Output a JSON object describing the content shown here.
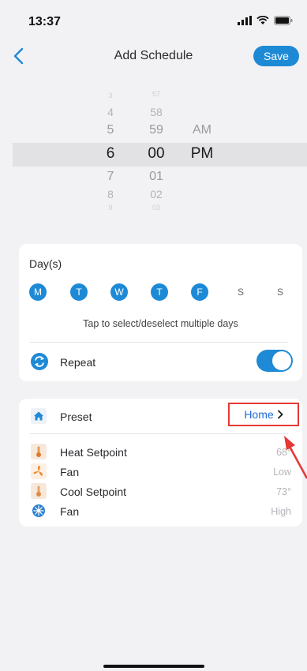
{
  "status_bar": {
    "time": "13:37"
  },
  "header": {
    "title": "Add Schedule",
    "save_label": "Save"
  },
  "time_picker": {
    "hours": [
      "3",
      "4",
      "5",
      "6",
      "7",
      "8",
      "9"
    ],
    "minutes": [
      "57",
      "58",
      "59",
      "00",
      "01",
      "02",
      "03"
    ],
    "meridiem": [
      "AM",
      "PM"
    ],
    "selected": {
      "hour": "6",
      "minute": "00",
      "meridiem": "PM"
    }
  },
  "days_card": {
    "title": "Day(s)",
    "days": [
      {
        "label": "M",
        "selected": true
      },
      {
        "label": "T",
        "selected": true
      },
      {
        "label": "W",
        "selected": true
      },
      {
        "label": "T",
        "selected": true
      },
      {
        "label": "F",
        "selected": true
      },
      {
        "label": "S",
        "selected": false
      },
      {
        "label": "S",
        "selected": false
      }
    ],
    "hint": "Tap to select/deselect multiple days",
    "repeat_label": "Repeat",
    "repeat_on": true
  },
  "preset_card": {
    "preset_label": "Preset",
    "preset_value": "Home",
    "rows": [
      {
        "label": "Heat Setpoint",
        "value": "68°",
        "icon": "thermometer-icon"
      },
      {
        "label": "Fan",
        "value": "Low",
        "icon": "fan-icon"
      },
      {
        "label": "Cool Setpoint",
        "value": "73°",
        "icon": "thermometer-icon"
      },
      {
        "label": "Fan",
        "value": "High",
        "icon": "fan-high-icon"
      }
    ]
  },
  "colors": {
    "accent": "#1e8ad6",
    "highlight_box": "#e53935",
    "annotation_arrow": "#e53935"
  }
}
